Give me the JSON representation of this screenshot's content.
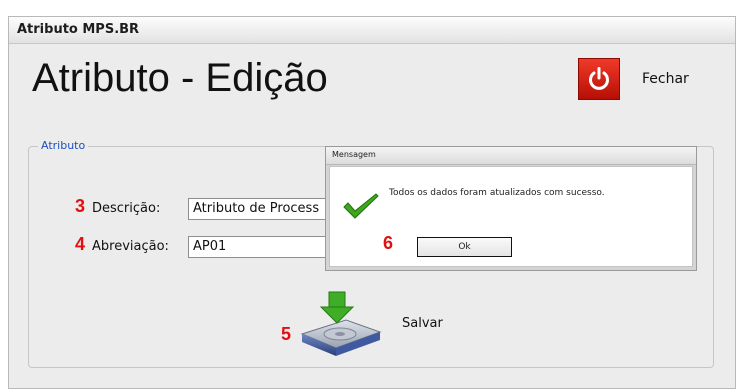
{
  "window": {
    "title": "Atributo MPS.BR"
  },
  "header": {
    "title": "Atributo - Edição",
    "close_label": "Fechar"
  },
  "form": {
    "group_label": "Atributo",
    "fields": [
      {
        "marker": "3",
        "label": "Descrição:",
        "value": "Atributo de Process"
      },
      {
        "marker": "4",
        "label": "Abreviação:",
        "value": "AP01"
      }
    ],
    "save_marker": "5",
    "save_label": "Salvar"
  },
  "dialog": {
    "title": "Mensagem",
    "message": "Todos os dados foram atualizados com sucesso.",
    "ok_marker": "6",
    "ok_label": "Ok"
  },
  "colors": {
    "close_button": "#d91f10",
    "marker": "#e01010",
    "legend": "#1b4fbf",
    "check": "#3da81c"
  },
  "icons": {
    "close": "power-icon",
    "save": "save-disk-icon",
    "success": "check-icon"
  }
}
